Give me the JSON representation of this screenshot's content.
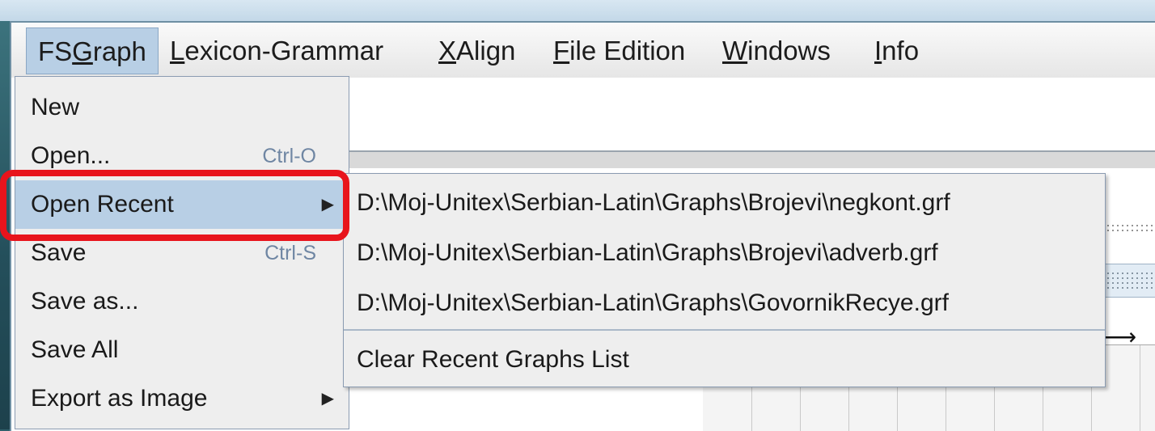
{
  "menubar": {
    "items": [
      {
        "pre": "FS",
        "ul": "G",
        "post": "raph",
        "active": true
      },
      {
        "pre": "",
        "ul": "L",
        "post": "exicon-Grammar",
        "active": false
      },
      {
        "pre": "",
        "ul": "X",
        "post": "Align",
        "active": false
      },
      {
        "pre": "",
        "ul": "F",
        "post": "ile Edition",
        "active": false
      },
      {
        "pre": "",
        "ul": "W",
        "post": "indows",
        "active": false
      },
      {
        "pre": "",
        "ul": "I",
        "post": "nfo",
        "active": false
      }
    ]
  },
  "fsgraph_menu": {
    "items": [
      {
        "label": "New",
        "shortcut": "",
        "submenu": false
      },
      {
        "label": "Open...",
        "shortcut": "Ctrl-O",
        "submenu": false
      },
      {
        "label": "Open Recent",
        "shortcut": "",
        "submenu": true
      },
      {
        "label": "Save",
        "shortcut": "Ctrl-S",
        "submenu": false
      },
      {
        "label": "Save as...",
        "shortcut": "",
        "submenu": false
      },
      {
        "label": "Save All",
        "shortcut": "",
        "submenu": false
      },
      {
        "label": "Export as Image",
        "shortcut": "",
        "submenu": true
      }
    ],
    "highlighted": "Open Recent"
  },
  "open_recent_submenu": {
    "items": [
      "D:\\Moj-Unitex\\Serbian-Latin\\Graphs\\Brojevi\\negkont.grf",
      "D:\\Moj-Unitex\\Serbian-Latin\\Graphs\\Brojevi\\adverb.grf",
      "D:\\Moj-Unitex\\Serbian-Latin\\Graphs\\GovornikRecye.grf"
    ],
    "clear_label": "Clear Recent Graphs List"
  },
  "colors": {
    "highlight_box": "#e8141c",
    "menu_hover": "#b8cfe5",
    "shortcut_text": "#6f86a3"
  }
}
